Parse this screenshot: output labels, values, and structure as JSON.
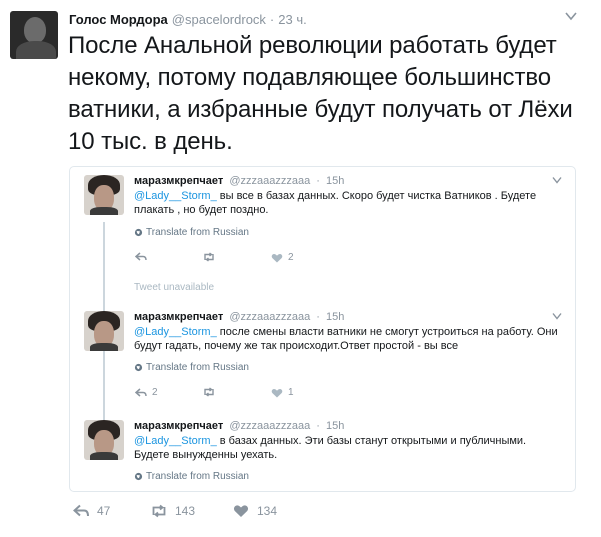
{
  "tweet": {
    "author_name": "Голос Мордора",
    "author_handle": "@spacelordrock",
    "separator": "·",
    "time": "23 ч.",
    "text": "После Анальной революции работать будет некому, потому подавляющее большинство ватники, а избранные будут получать от Лёхи 10 тыс. в день.",
    "actions": {
      "reply_count": "47",
      "retweet_count": "143",
      "like_count": "134"
    }
  },
  "quoted_thread": {
    "unavailable_label": "Tweet unavailable",
    "translate_label": "Translate from Russian",
    "replies": [
      {
        "name": "маразмкрепчает",
        "handle": "@zzzaaazzzaaa",
        "separator": "·",
        "time": "15h",
        "mention": "@Lady__Storm_",
        "text": " вы все в базах данных.  Скоро будет чистка  Ватников . Будете  плакать , но будет поздно.",
        "reply_count": "",
        "retweet_count": "",
        "like_count": "2"
      },
      {
        "name": "маразмкрепчает",
        "handle": "@zzzaaazzzaaa",
        "separator": "·",
        "time": "15h",
        "mention": "@Lady__Storm_",
        "text": " после смены власти ватники не смогут устроиться на работу. Они будут гадать, почему же так происходит.Ответ простой - вы все",
        "reply_count": "2",
        "retweet_count": "",
        "like_count": "1"
      },
      {
        "name": "маразмкрепчает",
        "handle": "@zzzaaazzzaaa",
        "separator": "·",
        "time": "15h",
        "mention": "@Lady__Storm_",
        "text": " в базах данных. Эти базы станут открытыми и публичными. Будете вынужденны уехать."
      }
    ]
  },
  "icons": {
    "reply": "reply-icon",
    "retweet": "retweet-icon",
    "like": "heart-icon",
    "translate": "globe-icon",
    "menu": "chevron-down-icon"
  },
  "colors": {
    "link": "#1b95e0",
    "muted": "#8a949e",
    "border": "#e1e8ed"
  }
}
